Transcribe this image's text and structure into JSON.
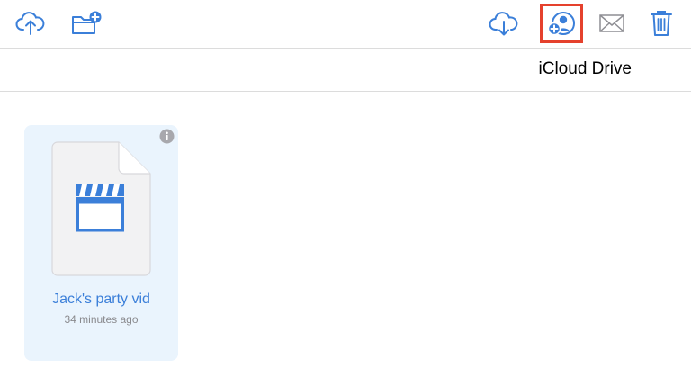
{
  "toolbar": {
    "upload": {
      "icon": "cloud-upload-icon"
    },
    "new_folder": {
      "icon": "folder-plus-icon"
    },
    "download": {
      "icon": "cloud-download-icon"
    },
    "share": {
      "icon": "add-person-icon",
      "highlight_color": "#e5412d"
    },
    "mail": {
      "icon": "envelope-icon"
    },
    "trash": {
      "icon": "trash-icon"
    }
  },
  "header": {
    "location": "iCloud Drive"
  },
  "files": [
    {
      "name": "Jack's party vid",
      "modified": "34 minutes ago",
      "type_icon": "video-clapperboard-icon",
      "selected": true
    }
  ],
  "colors": {
    "accent": "#3b7fd9",
    "icon_gray": "#8e8e93",
    "tile_bg": "#eaf4fd"
  }
}
